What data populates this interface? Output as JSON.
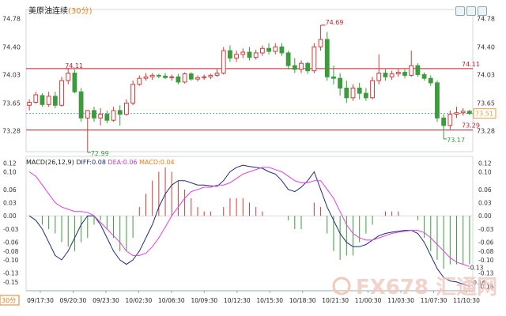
{
  "header": {
    "title": "美原油连续",
    "period": "(30分)"
  },
  "macd_legend": {
    "label": "MACD(26,12,9)",
    "diff": "DIFF:0.08",
    "dea": "DEA:0.06",
    "macd": "MACD:0.04"
  },
  "left_badge": "30分",
  "watermark": "FX678 汇通网",
  "chart_data": [
    {
      "type": "candlestick",
      "title": "美原油连续 (30分)",
      "y_ticks": [
        73.28,
        73.65,
        74.03,
        74.4,
        74.78
      ],
      "ylim": [
        73.0,
        74.9
      ],
      "x_ticks": [
        "09/17:30",
        "09/20:30",
        "09/23:30",
        "10/02:30",
        "10/06:30",
        "10/09:30",
        "10/12:30",
        "10/15:30",
        "10/18:30",
        "10/21:30",
        "11/00:30",
        "11/03:30",
        "11/07:30",
        "11/10:30"
      ],
      "candles": [
        {
          "o": 73.62,
          "h": 73.7,
          "l": 73.55,
          "c": 73.66
        },
        {
          "o": 73.66,
          "h": 73.8,
          "l": 73.64,
          "c": 73.76
        },
        {
          "o": 73.75,
          "h": 73.78,
          "l": 73.6,
          "c": 73.63
        },
        {
          "o": 73.63,
          "h": 73.8,
          "l": 73.6,
          "c": 73.74
        },
        {
          "o": 73.74,
          "h": 73.8,
          "l": 73.58,
          "c": 73.62
        },
        {
          "o": 73.62,
          "h": 74.0,
          "l": 73.6,
          "c": 73.95
        },
        {
          "o": 73.95,
          "h": 74.11,
          "l": 73.9,
          "c": 74.05
        },
        {
          "o": 74.05,
          "h": 74.1,
          "l": 73.78,
          "c": 73.8
        },
        {
          "o": 73.8,
          "h": 73.85,
          "l": 73.4,
          "c": 73.45
        },
        {
          "o": 73.45,
          "h": 73.55,
          "l": 72.99,
          "c": 73.55
        },
        {
          "o": 73.55,
          "h": 73.6,
          "l": 73.4,
          "c": 73.45
        },
        {
          "o": 73.45,
          "h": 73.58,
          "l": 73.35,
          "c": 73.5
        },
        {
          "o": 73.5,
          "h": 73.55,
          "l": 73.38,
          "c": 73.42
        },
        {
          "o": 73.42,
          "h": 73.6,
          "l": 73.4,
          "c": 73.55
        },
        {
          "o": 73.55,
          "h": 73.62,
          "l": 73.35,
          "c": 73.5
        },
        {
          "o": 73.5,
          "h": 73.7,
          "l": 73.48,
          "c": 73.65
        },
        {
          "o": 73.65,
          "h": 73.95,
          "l": 73.62,
          "c": 73.9
        },
        {
          "o": 73.9,
          "h": 74.02,
          "l": 73.88,
          "c": 73.98
        },
        {
          "o": 73.98,
          "h": 74.05,
          "l": 73.95,
          "c": 74.0
        },
        {
          "o": 74.0,
          "h": 74.05,
          "l": 73.96,
          "c": 74.02
        },
        {
          "o": 74.02,
          "h": 74.04,
          "l": 73.98,
          "c": 74.01
        },
        {
          "o": 74.01,
          "h": 74.05,
          "l": 73.97,
          "c": 73.99
        },
        {
          "o": 73.99,
          "h": 74.03,
          "l": 73.95,
          "c": 74.0
        },
        {
          "o": 74.0,
          "h": 74.04,
          "l": 73.9,
          "c": 73.93
        },
        {
          "o": 73.93,
          "h": 74.06,
          "l": 73.91,
          "c": 74.04
        },
        {
          "o": 74.04,
          "h": 74.06,
          "l": 73.95,
          "c": 73.97
        },
        {
          "o": 73.97,
          "h": 74.02,
          "l": 73.94,
          "c": 73.99
        },
        {
          "o": 73.99,
          "h": 74.03,
          "l": 73.96,
          "c": 74.0
        },
        {
          "o": 74.0,
          "h": 74.04,
          "l": 73.97,
          "c": 74.02
        },
        {
          "o": 74.02,
          "h": 74.1,
          "l": 74.0,
          "c": 74.05
        },
        {
          "o": 74.05,
          "h": 74.4,
          "l": 74.03,
          "c": 74.35
        },
        {
          "o": 74.35,
          "h": 74.42,
          "l": 74.2,
          "c": 74.25
        },
        {
          "o": 74.25,
          "h": 74.35,
          "l": 74.2,
          "c": 74.3
        },
        {
          "o": 74.3,
          "h": 74.38,
          "l": 74.25,
          "c": 74.33
        },
        {
          "o": 74.33,
          "h": 74.4,
          "l": 74.22,
          "c": 74.26
        },
        {
          "o": 74.26,
          "h": 74.36,
          "l": 74.23,
          "c": 74.32
        },
        {
          "o": 74.32,
          "h": 74.42,
          "l": 74.28,
          "c": 74.38
        },
        {
          "o": 74.38,
          "h": 74.45,
          "l": 74.3,
          "c": 74.34
        },
        {
          "o": 74.34,
          "h": 74.45,
          "l": 74.3,
          "c": 74.4
        },
        {
          "o": 74.4,
          "h": 74.45,
          "l": 74.28,
          "c": 74.32
        },
        {
          "o": 74.32,
          "h": 74.35,
          "l": 74.1,
          "c": 74.15
        },
        {
          "o": 74.15,
          "h": 74.25,
          "l": 74.05,
          "c": 74.1
        },
        {
          "o": 74.1,
          "h": 74.22,
          "l": 74.05,
          "c": 74.18
        },
        {
          "o": 74.18,
          "h": 74.2,
          "l": 74.04,
          "c": 74.08
        },
        {
          "o": 74.08,
          "h": 74.45,
          "l": 74.05,
          "c": 74.4
        },
        {
          "o": 74.4,
          "h": 74.69,
          "l": 74.35,
          "c": 74.5
        },
        {
          "o": 74.5,
          "h": 74.6,
          "l": 73.95,
          "c": 74.0
        },
        {
          "o": 74.0,
          "h": 74.15,
          "l": 73.9,
          "c": 73.98
        },
        {
          "o": 73.98,
          "h": 74.05,
          "l": 73.75,
          "c": 73.85
        },
        {
          "o": 73.85,
          "h": 73.95,
          "l": 73.65,
          "c": 73.72
        },
        {
          "o": 73.72,
          "h": 73.9,
          "l": 73.68,
          "c": 73.85
        },
        {
          "o": 73.85,
          "h": 73.92,
          "l": 73.7,
          "c": 73.78
        },
        {
          "o": 73.78,
          "h": 73.85,
          "l": 73.68,
          "c": 73.72
        },
        {
          "o": 73.72,
          "h": 74.0,
          "l": 73.7,
          "c": 73.95
        },
        {
          "o": 73.95,
          "h": 74.3,
          "l": 73.9,
          "c": 74.05
        },
        {
          "o": 74.05,
          "h": 74.1,
          "l": 73.95,
          "c": 74.0
        },
        {
          "o": 74.0,
          "h": 74.08,
          "l": 73.96,
          "c": 74.04
        },
        {
          "o": 74.04,
          "h": 74.1,
          "l": 74.0,
          "c": 74.06
        },
        {
          "o": 74.06,
          "h": 74.1,
          "l": 73.98,
          "c": 74.02
        },
        {
          "o": 74.02,
          "h": 74.35,
          "l": 74.0,
          "c": 74.15
        },
        {
          "o": 74.15,
          "h": 74.18,
          "l": 74.0,
          "c": 74.03
        },
        {
          "o": 74.03,
          "h": 74.06,
          "l": 73.95,
          "c": 73.98
        },
        {
          "o": 73.98,
          "h": 74.02,
          "l": 73.88,
          "c": 73.92
        },
        {
          "o": 73.92,
          "h": 73.95,
          "l": 73.4,
          "c": 73.45
        },
        {
          "o": 73.45,
          "h": 73.5,
          "l": 73.17,
          "c": 73.35
        },
        {
          "o": 73.35,
          "h": 73.55,
          "l": 73.3,
          "c": 73.5
        },
        {
          "o": 73.5,
          "h": 73.6,
          "l": 73.45,
          "c": 73.52
        },
        {
          "o": 73.52,
          "h": 73.58,
          "l": 73.48,
          "c": 73.54
        },
        {
          "o": 73.54,
          "h": 73.56,
          "l": 73.49,
          "c": 73.51
        }
      ],
      "hlines": [
        {
          "value": 74.11,
          "label": "74.11",
          "color": "#c8232c"
        },
        {
          "value": 73.29,
          "label": "73.29",
          "color": "#c8232c"
        },
        {
          "value": 73.51,
          "label": "73.51",
          "color": "#e8a040"
        }
      ],
      "annotations": [
        {
          "value": 74.69,
          "label": "74.69"
        },
        {
          "value": 74.11,
          "label": "74.11"
        },
        {
          "value": 72.99,
          "label": "72.99"
        },
        {
          "value": 73.17,
          "label": "73.17"
        }
      ]
    },
    {
      "type": "macd",
      "title": "MACD(26,12,9)",
      "y_ticks_left": [
        0.12,
        0.1,
        0.06,
        0.03,
        0.0,
        -0.03,
        -0.06,
        -0.08,
        -0.1,
        -0.13,
        -0.15
      ],
      "y_ticks_right": [
        0.12,
        0.1,
        0.06,
        0.03,
        0.0,
        -0.03,
        -0.06,
        -0.08,
        -0.1,
        -0.13,
        -0.16
      ],
      "ylim": [
        -0.17,
        0.135
      ],
      "series": [
        {
          "name": "DIFF",
          "color": "#1f2b7a",
          "values": [
            0.0,
            -0.01,
            -0.03,
            -0.06,
            -0.09,
            -0.1,
            -0.08,
            -0.05,
            -0.02,
            0.0,
            0.0,
            -0.02,
            -0.05,
            -0.08,
            -0.1,
            -0.11,
            -0.1,
            -0.08,
            -0.05,
            -0.02,
            0.02,
            0.05,
            0.07,
            0.08,
            0.08,
            0.075,
            0.07,
            0.07,
            0.068,
            0.067,
            0.08,
            0.1,
            0.11,
            0.115,
            0.112,
            0.11,
            0.108,
            0.1,
            0.095,
            0.08,
            0.06,
            0.055,
            0.065,
            0.08,
            0.1,
            0.06,
            0.02,
            -0.01,
            -0.04,
            -0.06,
            -0.07,
            -0.07,
            -0.065,
            -0.055,
            -0.045,
            -0.04,
            -0.037,
            -0.035,
            -0.033,
            -0.033,
            -0.04,
            -0.06,
            -0.09,
            -0.12,
            -0.14,
            -0.148,
            -0.15,
            -0.155,
            -0.16
          ]
        },
        {
          "name": "DEA",
          "color": "#e040e0",
          "values": [
            0.1,
            0.09,
            0.07,
            0.05,
            0.03,
            0.02,
            0.015,
            0.01,
            0.01,
            0.008,
            0.0,
            -0.015,
            -0.03,
            -0.045,
            -0.06,
            -0.08,
            -0.09,
            -0.09,
            -0.085,
            -0.07,
            -0.05,
            -0.025,
            0.0,
            0.02,
            0.04,
            0.055,
            0.06,
            0.065,
            0.065,
            0.07,
            0.07,
            0.075,
            0.085,
            0.095,
            0.1,
            0.105,
            0.11,
            0.11,
            0.105,
            0.1,
            0.09,
            0.08,
            0.075,
            0.075,
            0.08,
            0.08,
            0.06,
            0.04,
            0.01,
            -0.02,
            -0.04,
            -0.05,
            -0.055,
            -0.055,
            -0.05,
            -0.045,
            -0.04,
            -0.037,
            -0.035,
            -0.033,
            -0.033,
            -0.038,
            -0.05,
            -0.065,
            -0.08,
            -0.095,
            -0.105,
            -0.11,
            -0.115
          ]
        },
        {
          "name": "MACD",
          "color": "#c83232",
          "values": [
            0.0,
            0.0,
            -0.02,
            -0.03,
            -0.04,
            -0.06,
            -0.07,
            -0.08,
            -0.06,
            -0.05,
            -0.02,
            -0.01,
            -0.03,
            -0.05,
            -0.08,
            -0.08,
            -0.05,
            0.02,
            0.05,
            0.08,
            0.1,
            0.11,
            0.1,
            0.08,
            0.06,
            0.04,
            0.02,
            0.01,
            0.01,
            0.0,
            0.02,
            0.04,
            0.04,
            0.04,
            0.03,
            0.02,
            0.01,
            0.0,
            0.0,
            0.0,
            -0.01,
            -0.03,
            -0.03,
            0.0,
            0.03,
            0.02,
            -0.04,
            -0.08,
            -0.1,
            -0.09,
            -0.09,
            -0.06,
            -0.04,
            -0.02,
            0.0,
            0.01,
            0.01,
            0.01,
            0.0,
            0.0,
            -0.01,
            -0.05,
            -0.08,
            -0.1,
            -0.12,
            -0.11,
            -0.11,
            -0.11,
            -0.11
          ]
        }
      ],
      "annotations": [
        {
          "value": -0.13,
          "label": "-0.13"
        },
        {
          "value": -0.09,
          "label": "-0.09"
        }
      ]
    }
  ]
}
